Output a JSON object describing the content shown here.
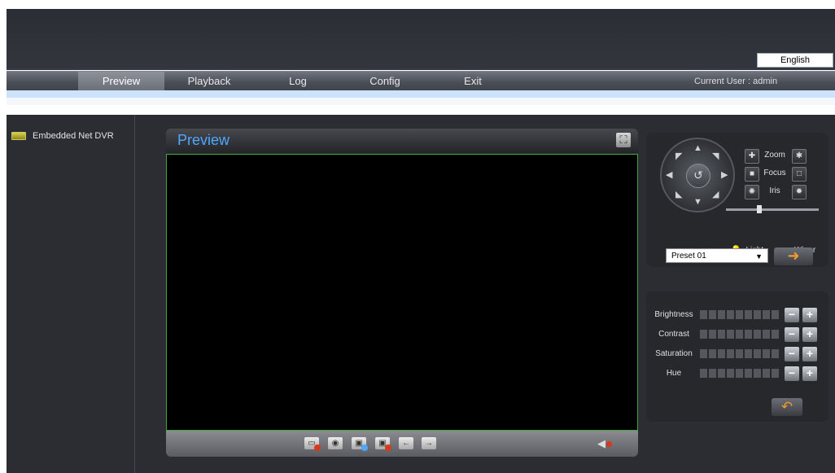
{
  "header": {
    "language": "English",
    "current_user": "Current User : admin"
  },
  "nav": {
    "items": [
      "Preview",
      "Playback",
      "Log",
      "Config",
      "Exit"
    ],
    "active": "Preview"
  },
  "sidebar": {
    "device": "Embedded Net DVR"
  },
  "preview": {
    "title": "Preview"
  },
  "ptz": {
    "zoom_label": "Zoom",
    "focus_label": "Focus",
    "iris_label": "Iris",
    "light_label": "Light",
    "wiper_label": "Wiper",
    "preset_value": "Preset 01"
  },
  "image": {
    "brightness_label": "Brightness",
    "contrast_label": "Contrast",
    "saturation_label": "Saturation",
    "hue_label": "Hue"
  },
  "colors": {
    "accent_title": "#4ea8ff",
    "video_border": "#3ca83c",
    "arrow_orange": "#f19b2c",
    "record_red": "#d63a1a"
  }
}
